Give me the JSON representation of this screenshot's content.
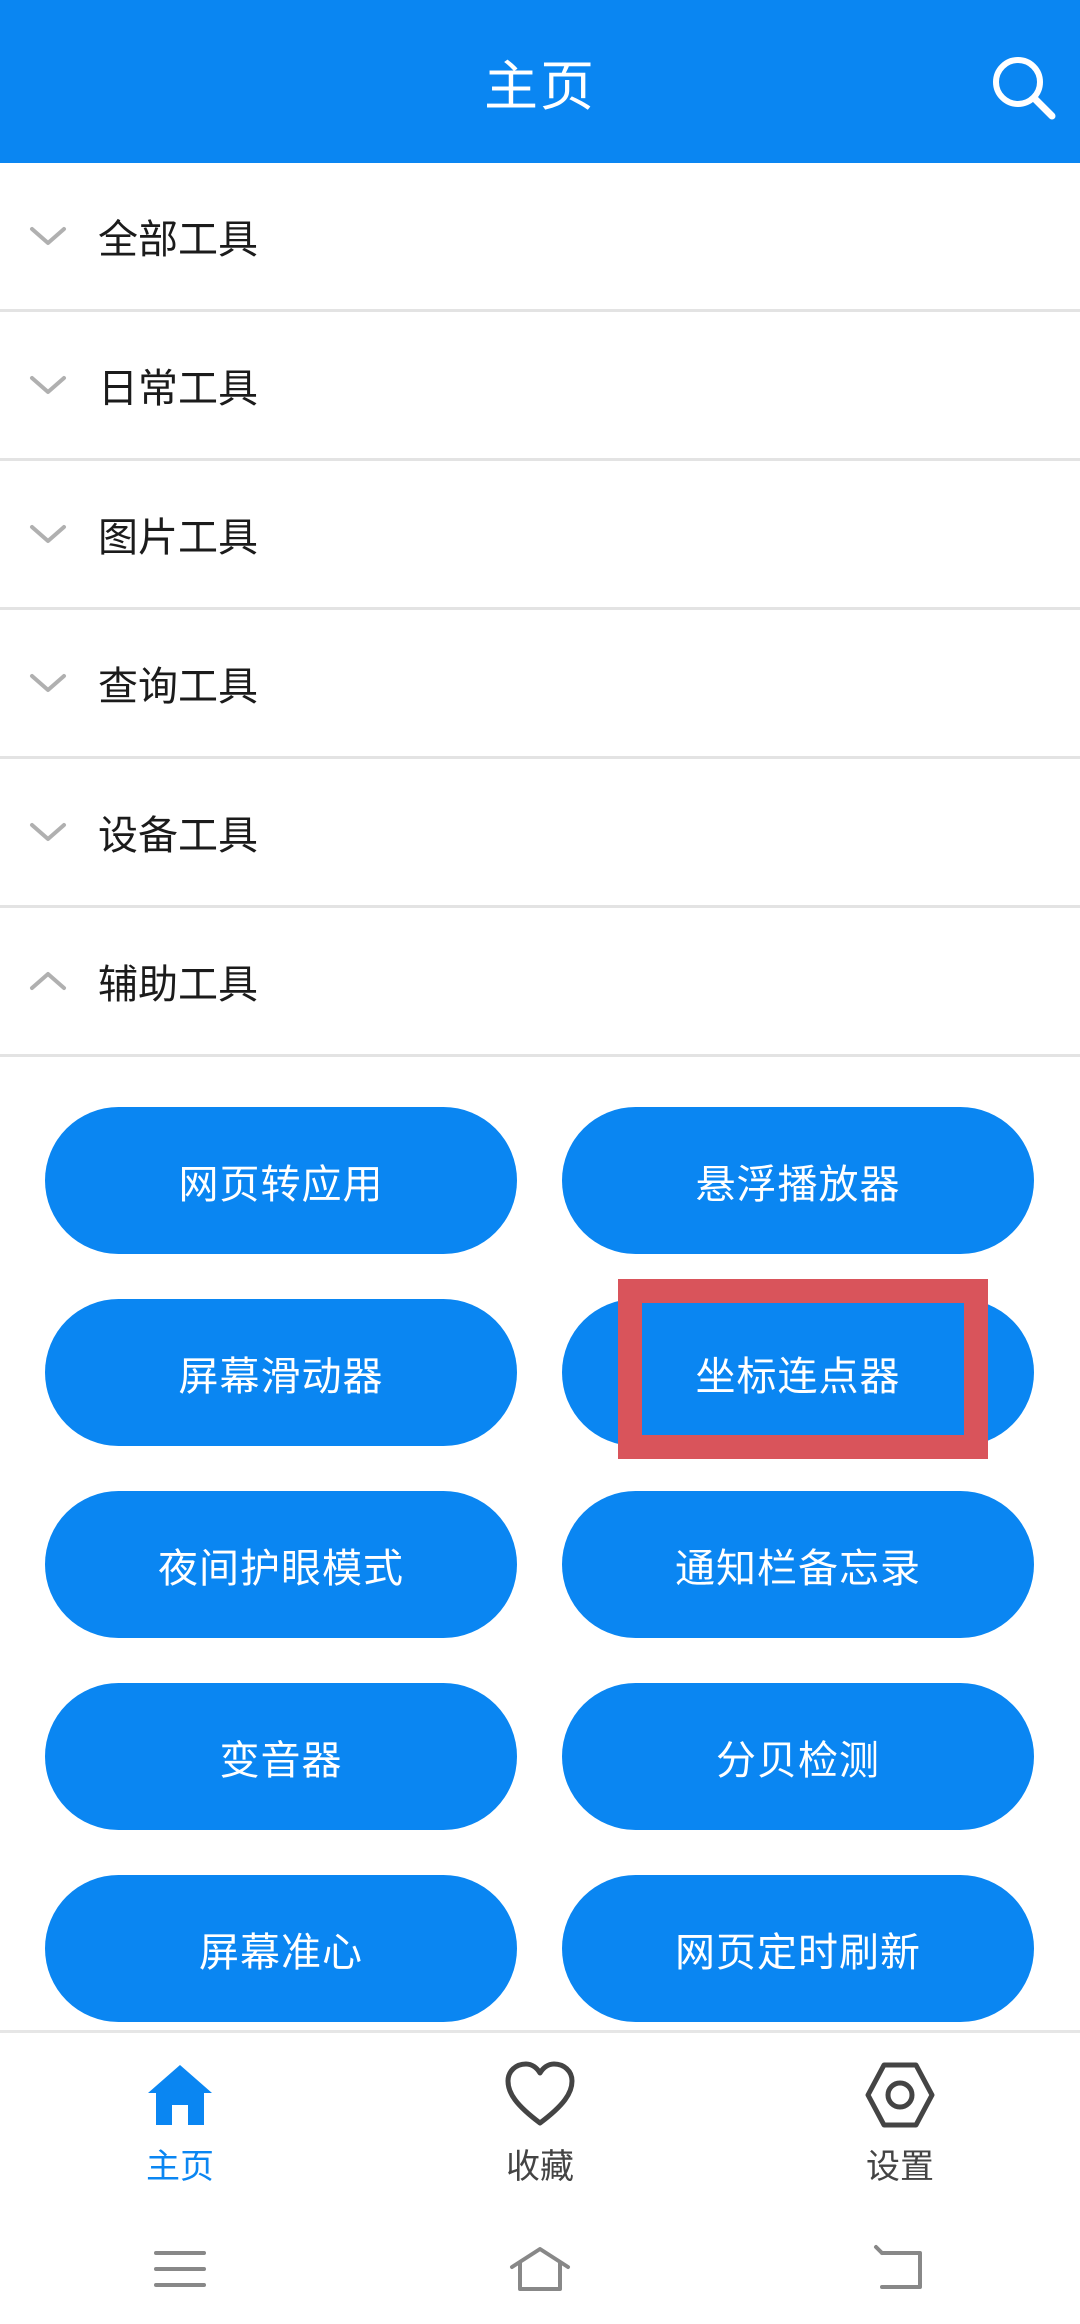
{
  "header": {
    "title": "主页",
    "bg_color": "#0a86f2",
    "search_icon": "search-icon"
  },
  "categories": [
    {
      "label": "全部工具",
      "expanded": false
    },
    {
      "label": "日常工具",
      "expanded": false
    },
    {
      "label": "图片工具",
      "expanded": false
    },
    {
      "label": "查询工具",
      "expanded": false
    },
    {
      "label": "设备工具",
      "expanded": false
    },
    {
      "label": "辅助工具",
      "expanded": true
    }
  ],
  "tools": [
    {
      "label": "网页转应用"
    },
    {
      "label": "悬浮播放器"
    },
    {
      "label": "屏幕滑动器"
    },
    {
      "label": "坐标连点器",
      "highlighted": true
    },
    {
      "label": "夜间护眼模式"
    },
    {
      "label": "通知栏备忘录"
    },
    {
      "label": "变音器"
    },
    {
      "label": "分贝检测"
    },
    {
      "label": "屏幕准心"
    },
    {
      "label": "网页定时刷新"
    }
  ],
  "bottom_nav": [
    {
      "label": "主页",
      "icon": "home-icon",
      "active": true
    },
    {
      "label": "收藏",
      "icon": "heart-icon",
      "active": false
    },
    {
      "label": "设置",
      "icon": "gear-icon",
      "active": false
    }
  ],
  "system_bar": {
    "icons": [
      "menu-icon",
      "home-outline-icon",
      "back-icon"
    ]
  },
  "colors": {
    "accent": "#0a86f2",
    "highlight": "#d9545b"
  }
}
